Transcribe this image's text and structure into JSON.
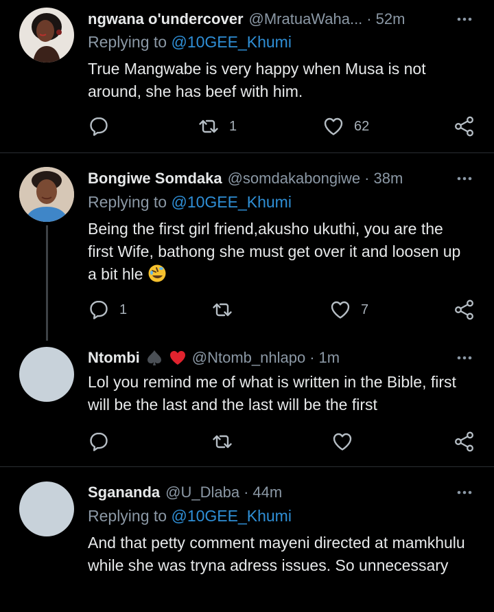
{
  "tweets": [
    {
      "name": "ngwana o'undercover",
      "handle": "@MratuaWaha...",
      "time": "52m",
      "replying_prefix": "Replying to ",
      "mention": "@10GEE_Khumi",
      "text": "True Mangwabe is very happy when Musa is not around, she has beef with him.",
      "reply_count": "",
      "retweet_count": "1",
      "like_count": "62"
    },
    {
      "name": "Bongiwe Somdaka",
      "handle": "@somdakabongiwe",
      "time": "38m",
      "replying_prefix": "Replying to ",
      "mention": "@10GEE_Khumi",
      "text": "Being the first girl friend,akusho ukuthi, you are the first Wife, bathong she must get over it and loosen up a bit hle",
      "emoji": "rolling-on-floor-laughing",
      "reply_count": "1",
      "retweet_count": "",
      "like_count": "7"
    },
    {
      "name": "Ntombi",
      "badges": [
        "spade",
        "red-heart"
      ],
      "handle": "@Ntomb_nhlapo",
      "time": "1m",
      "text": "Lol you remind me of what is written in the Bible, first will be the last and the last will be the first",
      "reply_count": "",
      "retweet_count": "",
      "like_count": ""
    },
    {
      "name": "Sgananda",
      "handle": "@U_Dlaba",
      "time": "44m",
      "replying_prefix": "Replying to ",
      "mention": "@10GEE_Khumi",
      "text": "And that petty comment mayeni directed at mamkhulu while she was tryna adress issues. So unnecessary"
    }
  ],
  "separator": "·",
  "colors": {
    "background": "#000000",
    "link": "#2f8fd6",
    "muted": "#8b98a5",
    "text": "#e7e9ea"
  },
  "icons": [
    "reply-icon",
    "retweet-icon",
    "like-icon",
    "share-icon",
    "more-icon"
  ]
}
